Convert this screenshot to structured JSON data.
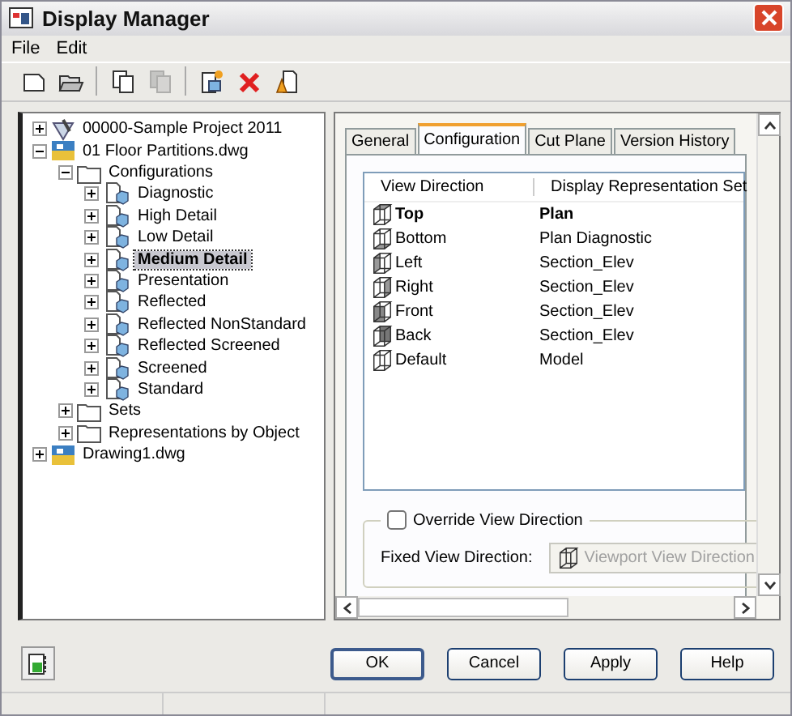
{
  "window": {
    "title": "Display Manager"
  },
  "menu": [
    "File",
    "Edit"
  ],
  "toolbar": [
    {
      "kind": "new",
      "disabled": false
    },
    {
      "kind": "open",
      "disabled": false
    },
    {
      "kind": "sep"
    },
    {
      "kind": "copy",
      "disabled": false
    },
    {
      "kind": "paste",
      "disabled": true
    },
    {
      "kind": "sep"
    },
    {
      "kind": "newconfig",
      "disabled": false
    },
    {
      "kind": "delete",
      "disabled": false
    },
    {
      "kind": "purge",
      "disabled": false
    }
  ],
  "tree": [
    {
      "label": "00000-Sample Project 2011",
      "kind": "project",
      "expanded": false,
      "selected": false
    },
    {
      "label": "01 Floor Partitions.dwg",
      "kind": "drawing",
      "expanded": true,
      "selected": false,
      "children": [
        {
          "label": "Configurations",
          "kind": "folder",
          "expanded": true,
          "selected": false,
          "children": [
            {
              "label": "Diagnostic",
              "kind": "config",
              "expanded": false,
              "selected": false
            },
            {
              "label": "High Detail",
              "kind": "config",
              "expanded": false,
              "selected": false
            },
            {
              "label": "Low Detail",
              "kind": "config",
              "expanded": false,
              "selected": false
            },
            {
              "label": "Medium Detail",
              "kind": "config",
              "expanded": false,
              "selected": true
            },
            {
              "label": "Presentation",
              "kind": "config",
              "expanded": false,
              "selected": false
            },
            {
              "label": "Reflected",
              "kind": "config",
              "expanded": false,
              "selected": false
            },
            {
              "label": "Reflected NonStandard",
              "kind": "config",
              "expanded": false,
              "selected": false
            },
            {
              "label": "Reflected Screened",
              "kind": "config",
              "expanded": false,
              "selected": false
            },
            {
              "label": "Screened",
              "kind": "config",
              "expanded": false,
              "selected": false
            },
            {
              "label": "Standard",
              "kind": "config",
              "expanded": false,
              "selected": false
            }
          ]
        },
        {
          "label": "Sets",
          "kind": "folder",
          "expanded": false,
          "selected": false
        },
        {
          "label": "Representations by Object",
          "kind": "folder",
          "expanded": false,
          "selected": false
        }
      ]
    },
    {
      "label": "Drawing1.dwg",
      "kind": "drawing",
      "expanded": false,
      "selected": false
    }
  ],
  "tabs": [
    {
      "label": "General",
      "selected": false
    },
    {
      "label": "Configuration",
      "selected": true
    },
    {
      "label": "Cut Plane",
      "selected": false
    },
    {
      "label": "Version History",
      "selected": false
    }
  ],
  "list": {
    "columns": [
      "View Direction",
      "Display Representation Set"
    ],
    "rows": [
      {
        "view": "Top",
        "set": "Plan",
        "kind": "top",
        "active": true
      },
      {
        "view": "Bottom",
        "set": "Plan Diagnostic",
        "kind": "bottom",
        "active": false
      },
      {
        "view": "Left",
        "set": "Section_Elev",
        "kind": "left",
        "active": false
      },
      {
        "view": "Right",
        "set": "Section_Elev",
        "kind": "right",
        "active": false
      },
      {
        "view": "Front",
        "set": "Section_Elev",
        "kind": "front",
        "active": false
      },
      {
        "view": "Back",
        "set": "Section_Elev",
        "kind": "back",
        "active": false
      },
      {
        "view": "Default",
        "set": "Model",
        "kind": "default",
        "active": false
      }
    ]
  },
  "override": {
    "label": "Override View Direction",
    "checked": false
  },
  "fixed": {
    "label": "Fixed View Direction:",
    "button": "Viewport View Direction",
    "disabled": true
  },
  "buttons": [
    {
      "label": "OK",
      "default": true
    },
    {
      "label": "Cancel",
      "default": false
    },
    {
      "label": "Apply",
      "default": false
    },
    {
      "label": "Help",
      "default": false
    }
  ]
}
